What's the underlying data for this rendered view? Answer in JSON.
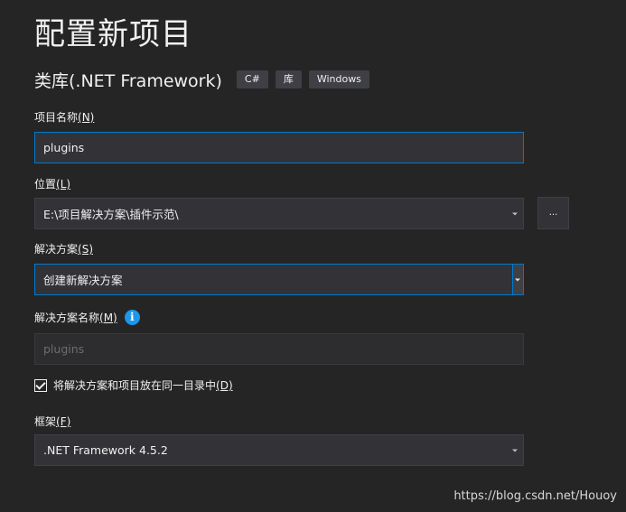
{
  "header": {
    "title": "配置新项目",
    "template_name": "类库(.NET Framework)",
    "tags": [
      "C#",
      "库",
      "Windows"
    ]
  },
  "project_name": {
    "label": "项目名称",
    "access_key": "(N)",
    "value": "plugins"
  },
  "location": {
    "label": "位置",
    "access_key": "(L)",
    "value": "E:\\项目解决方案\\插件示范\\",
    "browse_label": "..."
  },
  "solution": {
    "label": "解决方案",
    "access_key": "(S)",
    "value": "创建新解决方案"
  },
  "solution_name": {
    "label": "解决方案名称",
    "access_key": "(M)",
    "info_glyph": "i",
    "placeholder": "plugins"
  },
  "same_dir": {
    "label": "将解决方案和项目放在同一目录中",
    "access_key": "(D)",
    "checked": true
  },
  "framework": {
    "label": "框架",
    "access_key": "(F)",
    "value": ".NET Framework 4.5.2"
  },
  "watermark": "https://blog.csdn.net/Houoy",
  "colors": {
    "background": "#252526",
    "field": "#333337",
    "accent": "#007acc",
    "info": "#1c97ea"
  }
}
